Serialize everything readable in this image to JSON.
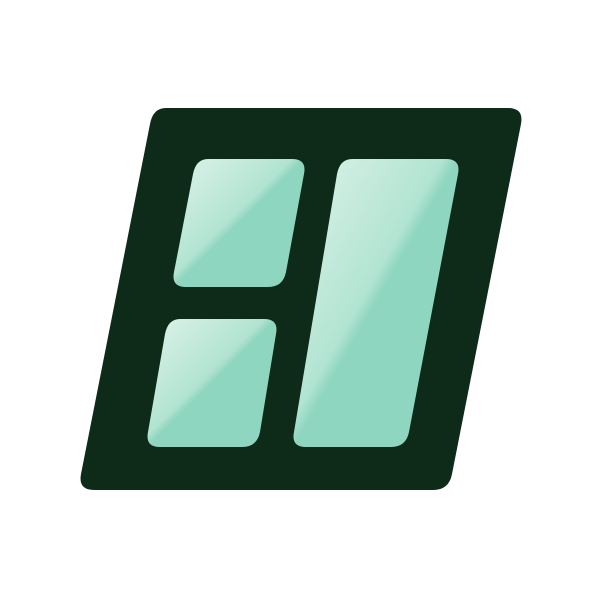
{
  "logo": {
    "icon": "layout-grid-icon",
    "colors": {
      "frame": "#0e2a18",
      "panel_light": "#dff3eb",
      "panel_mid": "#b2e4d2",
      "panel_base": "#8ed6bf",
      "background": "#ffffff"
    }
  }
}
